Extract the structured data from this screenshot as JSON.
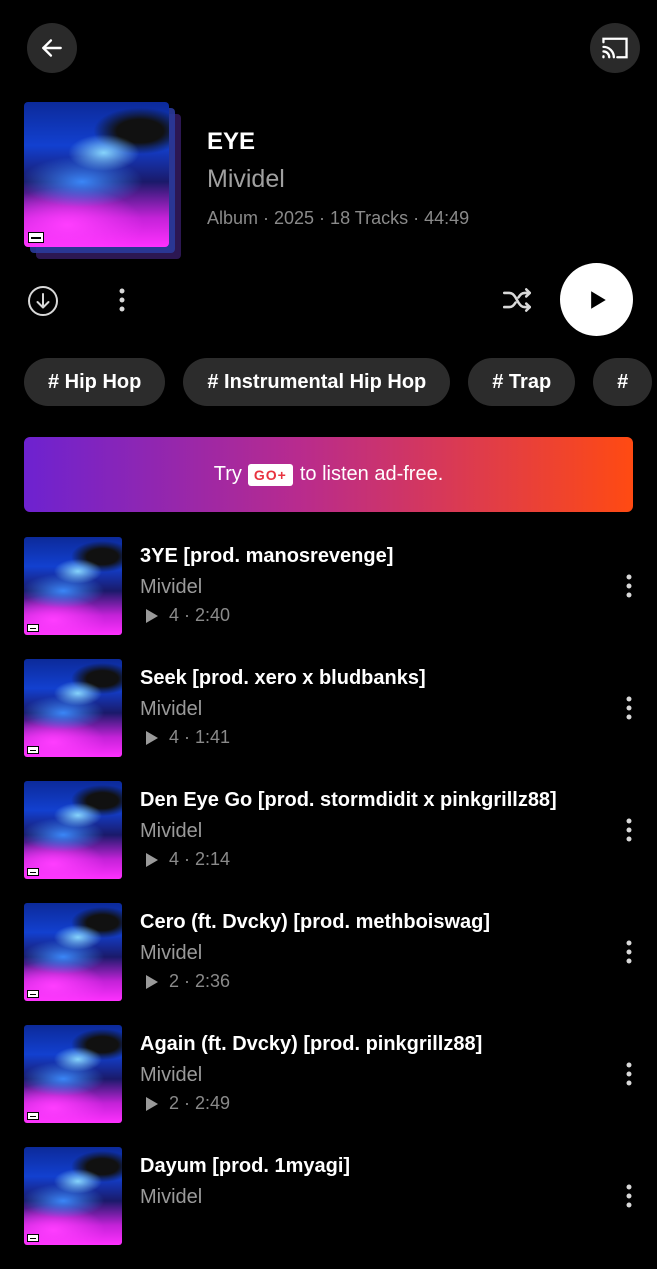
{
  "header": {
    "back_icon": "arrow-left-icon",
    "cast_icon": "cast-icon"
  },
  "album": {
    "title": "EYE",
    "artist": "Mividel",
    "meta": "Album · 2025 · 18 Tracks · 44:49"
  },
  "actions": {
    "download_icon": "download-icon",
    "more_icon": "more-vertical-icon",
    "shuffle_icon": "shuffle-icon",
    "play_icon": "play-icon"
  },
  "tags": [
    "# Hip Hop",
    "# Instrumental Hip Hop",
    "# Trap",
    "#"
  ],
  "banner": {
    "prefix": "Try",
    "badge": "GO+",
    "suffix": "to listen ad-free."
  },
  "tracks": [
    {
      "title": "3YE [prod. manosrevenge]",
      "artist": "Mividel",
      "stats": "4 · 2:40"
    },
    {
      "title": "Seek [prod. xero x bludbanks]",
      "artist": "Mividel",
      "stats": "4 · 1:41"
    },
    {
      "title": "Den Eye Go [prod. stormdidit x pinkgrillz88]",
      "artist": "Mividel",
      "stats": "4 · 2:14"
    },
    {
      "title": "Cero (ft. Dvcky) [prod. methboiswag]",
      "artist": "Mividel",
      "stats": "2 · 2:36"
    },
    {
      "title": "Again (ft. Dvcky) [prod. pinkgrillz88]",
      "artist": "Mividel",
      "stats": "2 · 2:49"
    },
    {
      "title": "Dayum [prod. 1myagi]",
      "artist": "Mividel",
      "stats": ""
    }
  ],
  "colors": {
    "background": "#000000",
    "chip": "#2c2c2c",
    "banner_start": "#6d22d0",
    "banner_end": "#ff4a12",
    "go_badge_text": "#e8333f"
  }
}
